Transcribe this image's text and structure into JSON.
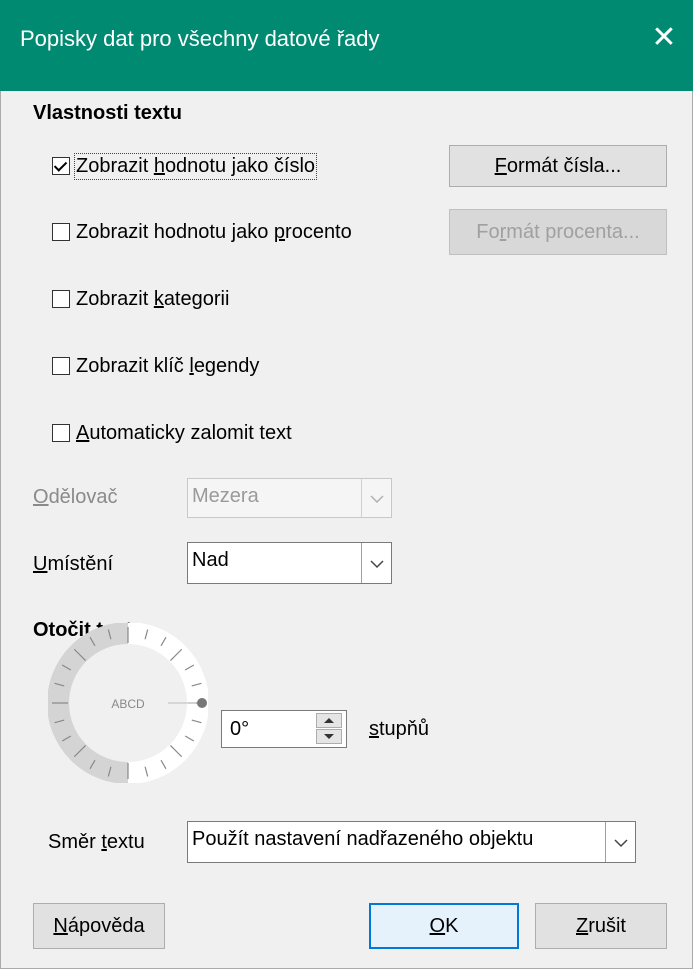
{
  "window": {
    "title": "Popisky dat pro všechny datové řady",
    "close_symbol": "✕"
  },
  "text_properties": {
    "heading": "Vlastnosti textu",
    "checkboxes": [
      {
        "pre": "Zobrazit ",
        "u": "h",
        "post": "odnotu jako číslo",
        "checked": true
      },
      {
        "pre": "Zobrazit hodnotu jako ",
        "u": "p",
        "post": "rocento",
        "checked": false
      },
      {
        "pre": "Zobrazit ",
        "u": "k",
        "post": "ategorii",
        "checked": false
      },
      {
        "pre": "Zobrazit klíč ",
        "u": "l",
        "post": "egendy",
        "checked": false
      },
      {
        "pre": "",
        "u": "A",
        "post": "utomaticky zalomit text",
        "checked": false
      }
    ],
    "number_format_button": {
      "u": "F",
      "post": "ormát čísla..."
    },
    "percent_format_button": {
      "pre": "Fo",
      "u": "r",
      "post": "mát procenta..."
    },
    "separator": {
      "u": "O",
      "post": "dělovač",
      "value": "Mezera"
    },
    "placement": {
      "u": "U",
      "post": "místění",
      "value": "Nad"
    }
  },
  "rotate": {
    "heading": "Otočit text",
    "dial_text": "ABCD",
    "degrees_value": "0°",
    "degrees_label": {
      "u": "s",
      "post": "tupňů"
    },
    "direction": {
      "pre": "Směr ",
      "u": "t",
      "post": "extu",
      "value": "Použít nastavení nadřazeného objektu"
    }
  },
  "footer": {
    "help": {
      "u": "N",
      "post": "ápověda"
    },
    "ok": {
      "u": "O",
      "post": "K"
    },
    "cancel": {
      "u": "Z",
      "post": "rušit"
    }
  }
}
